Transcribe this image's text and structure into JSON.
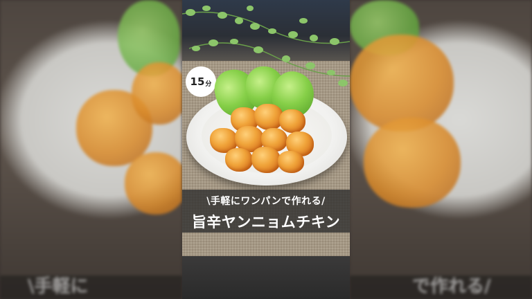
{
  "video": {
    "time_badge": {
      "number": "15",
      "unit": "分"
    },
    "subtitle": "\\手軽にワンパンで作れる/",
    "title": "旨辛ヤンニョムチキン"
  },
  "background": {
    "left_ghost_text": "\\手軽に",
    "right_ghost_text": "で作れる/"
  }
}
